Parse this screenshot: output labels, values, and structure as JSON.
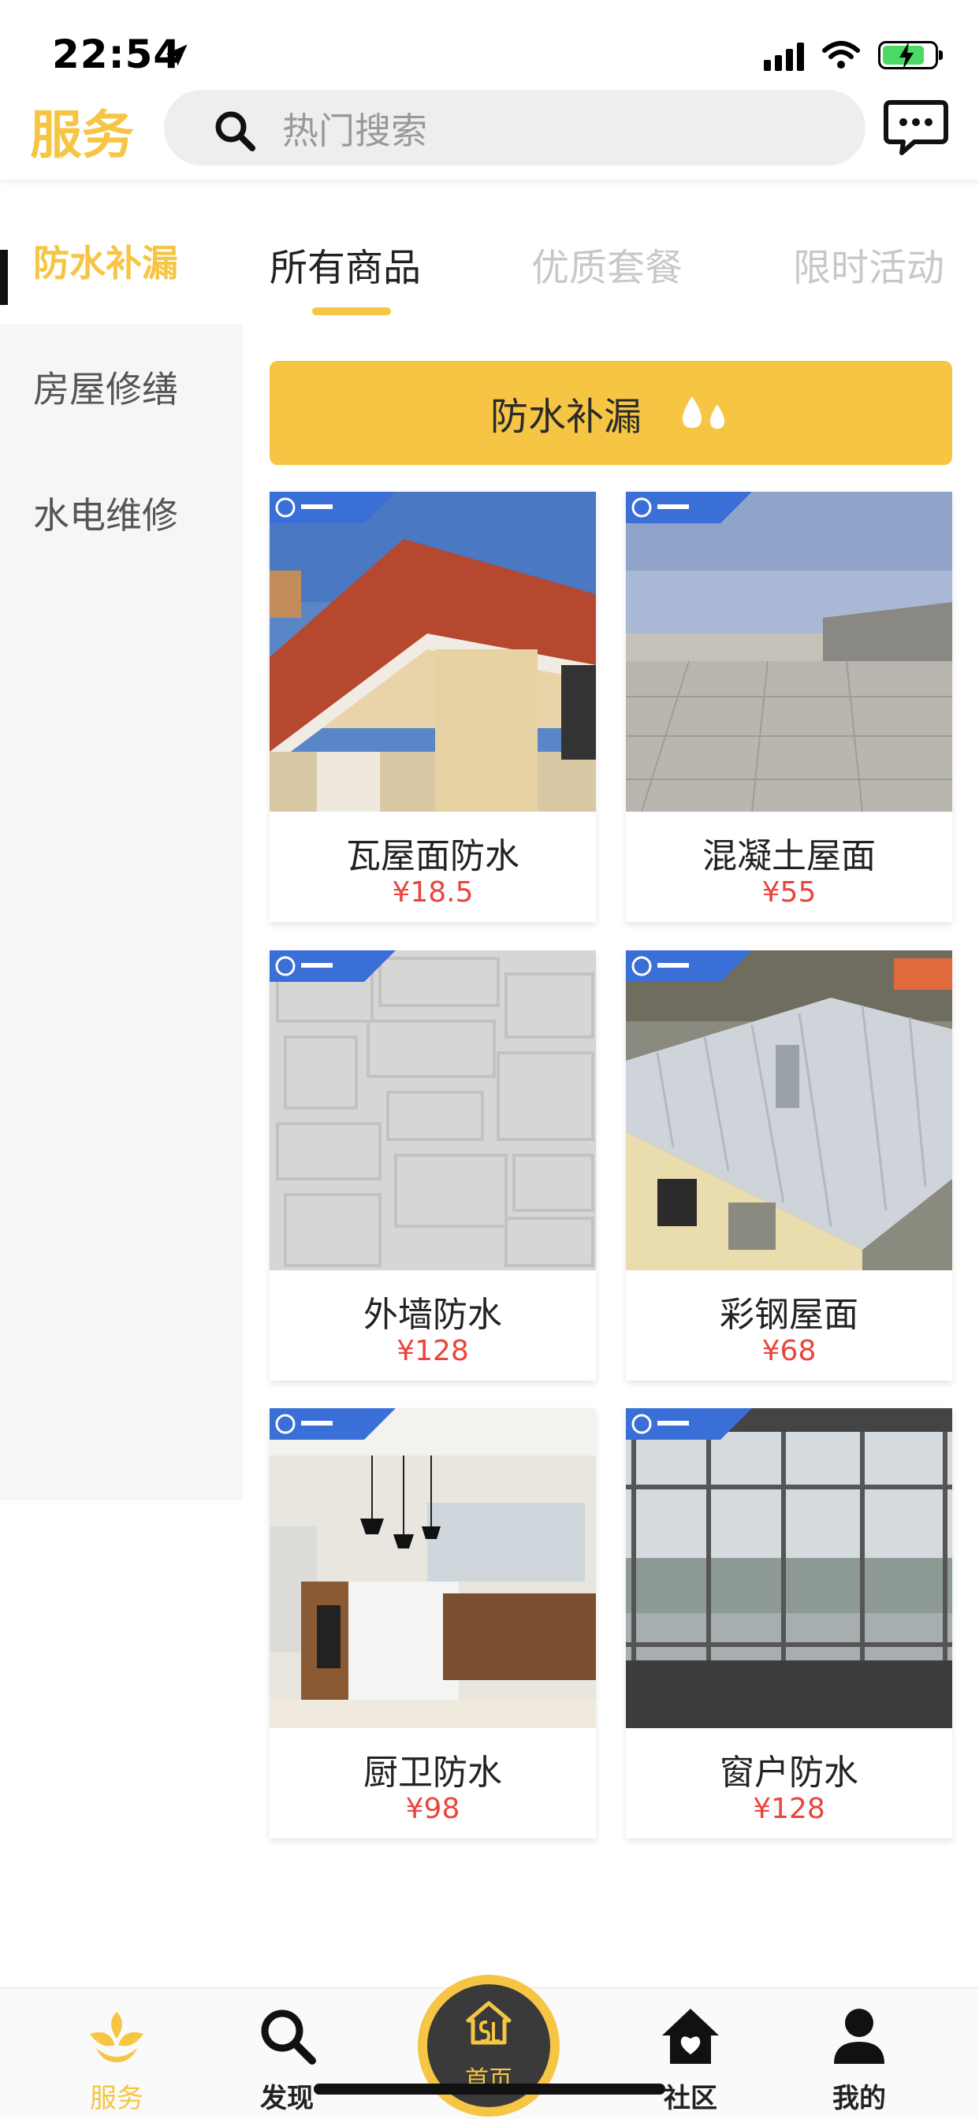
{
  "status_bar": {
    "time": "22:54"
  },
  "header": {
    "title": "服务",
    "search_placeholder": "热门搜索"
  },
  "sidebar": {
    "items": [
      {
        "label": "防水补漏",
        "active": true
      },
      {
        "label": "房屋修缮",
        "active": false
      },
      {
        "label": "水电维修",
        "active": false
      }
    ]
  },
  "tabs": [
    {
      "label": "所有商品",
      "active": true
    },
    {
      "label": "优质套餐",
      "active": false
    },
    {
      "label": "限时活动",
      "active": false
    }
  ],
  "banner": {
    "label": "防水补漏"
  },
  "products": [
    {
      "name": "瓦屋面防水",
      "price": "¥18.5"
    },
    {
      "name": "混凝土屋面",
      "price": "¥55"
    },
    {
      "name": "外墙防水",
      "price": "¥128"
    },
    {
      "name": "彩钢屋面",
      "price": "¥68"
    },
    {
      "name": "厨卫防水",
      "price": "¥98"
    },
    {
      "name": "窗户防水",
      "price": "¥128"
    }
  ],
  "bottom_nav": {
    "items": [
      {
        "label": "服务",
        "icon": "sprout-icon",
        "active": true
      },
      {
        "label": "发现",
        "icon": "search-icon",
        "active": false
      },
      {
        "label": "首页",
        "icon": "home-logo-icon",
        "active": false
      },
      {
        "label": "社区",
        "icon": "house-heart-icon",
        "active": false
      },
      {
        "label": "我的",
        "icon": "person-icon",
        "active": false
      }
    ]
  },
  "colors": {
    "accent": "#f5c543",
    "price": "#e8453c",
    "sidebar_bg": "#f6f6f6",
    "brand_tag": "#3b6fd8"
  }
}
